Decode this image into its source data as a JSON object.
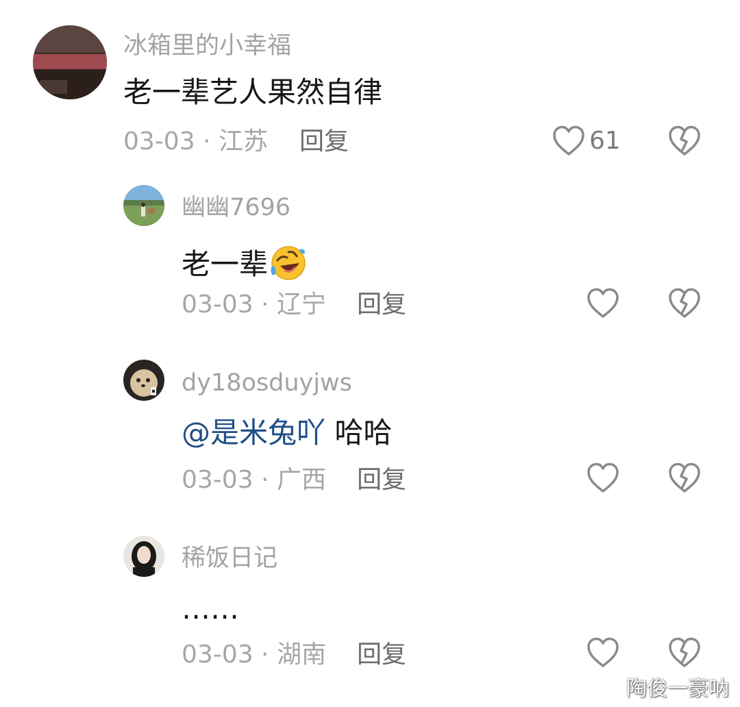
{
  "comments": [
    {
      "username": "冰箱里的小幸福",
      "text": "老一辈艺人果然自律",
      "date_location": "03-03 · 江苏",
      "reply_label": "回复",
      "like_count": "61"
    },
    {
      "username": "幽幽7696",
      "text": "老一辈",
      "emoji": "rolling-on-floor-laughing-emoji",
      "date_location": "03-03 · 辽宁",
      "reply_label": "回复"
    },
    {
      "username": "dy18osduyjws",
      "mention": "@是米兔吖",
      "text": "哈哈",
      "date_location": "03-03 · 广西",
      "reply_label": "回复"
    },
    {
      "username": "稀饭日记",
      "text": "……",
      "date_location": "03-03 · 湖南",
      "reply_label": "回复"
    }
  ],
  "watermark": "陶俊一豪呐",
  "colors": {
    "username": "#a3a3a3",
    "mention": "#1f4f86",
    "icon_stroke": "#8a8a8a"
  },
  "icons": [
    "heart-outline-icon",
    "broken-heart-icon"
  ]
}
